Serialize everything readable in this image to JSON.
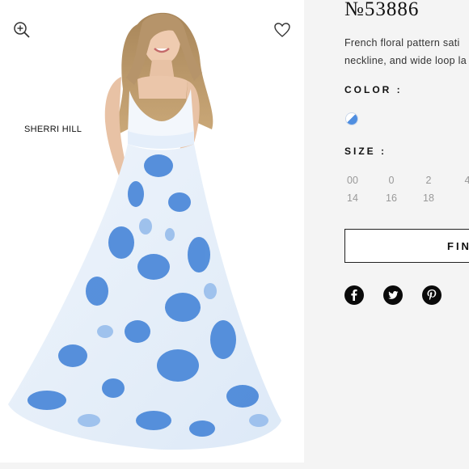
{
  "brand": "SHERRI HILL",
  "product": {
    "style_number": "№53886",
    "description_lines": [
      "French floral pattern sati",
      "neckline, and wide loop la"
    ]
  },
  "color": {
    "label": "COLOR :",
    "swatch_colors": [
      "#ffffff",
      "#4f8ee0"
    ]
  },
  "size": {
    "label": "SIZE :",
    "options": [
      "00",
      "0",
      "2",
      "4",
      "14",
      "16",
      "18"
    ]
  },
  "find_button": {
    "label": "FIN"
  },
  "icons": [
    "zoom-in-icon",
    "heart-icon",
    "facebook-icon",
    "twitter-icon",
    "pinterest-icon"
  ],
  "colors": {
    "background": "#f4f4f4",
    "panel": "#ffffff",
    "dress_blue": "#3d7fd6",
    "text": "#111111",
    "muted": "#999999"
  }
}
